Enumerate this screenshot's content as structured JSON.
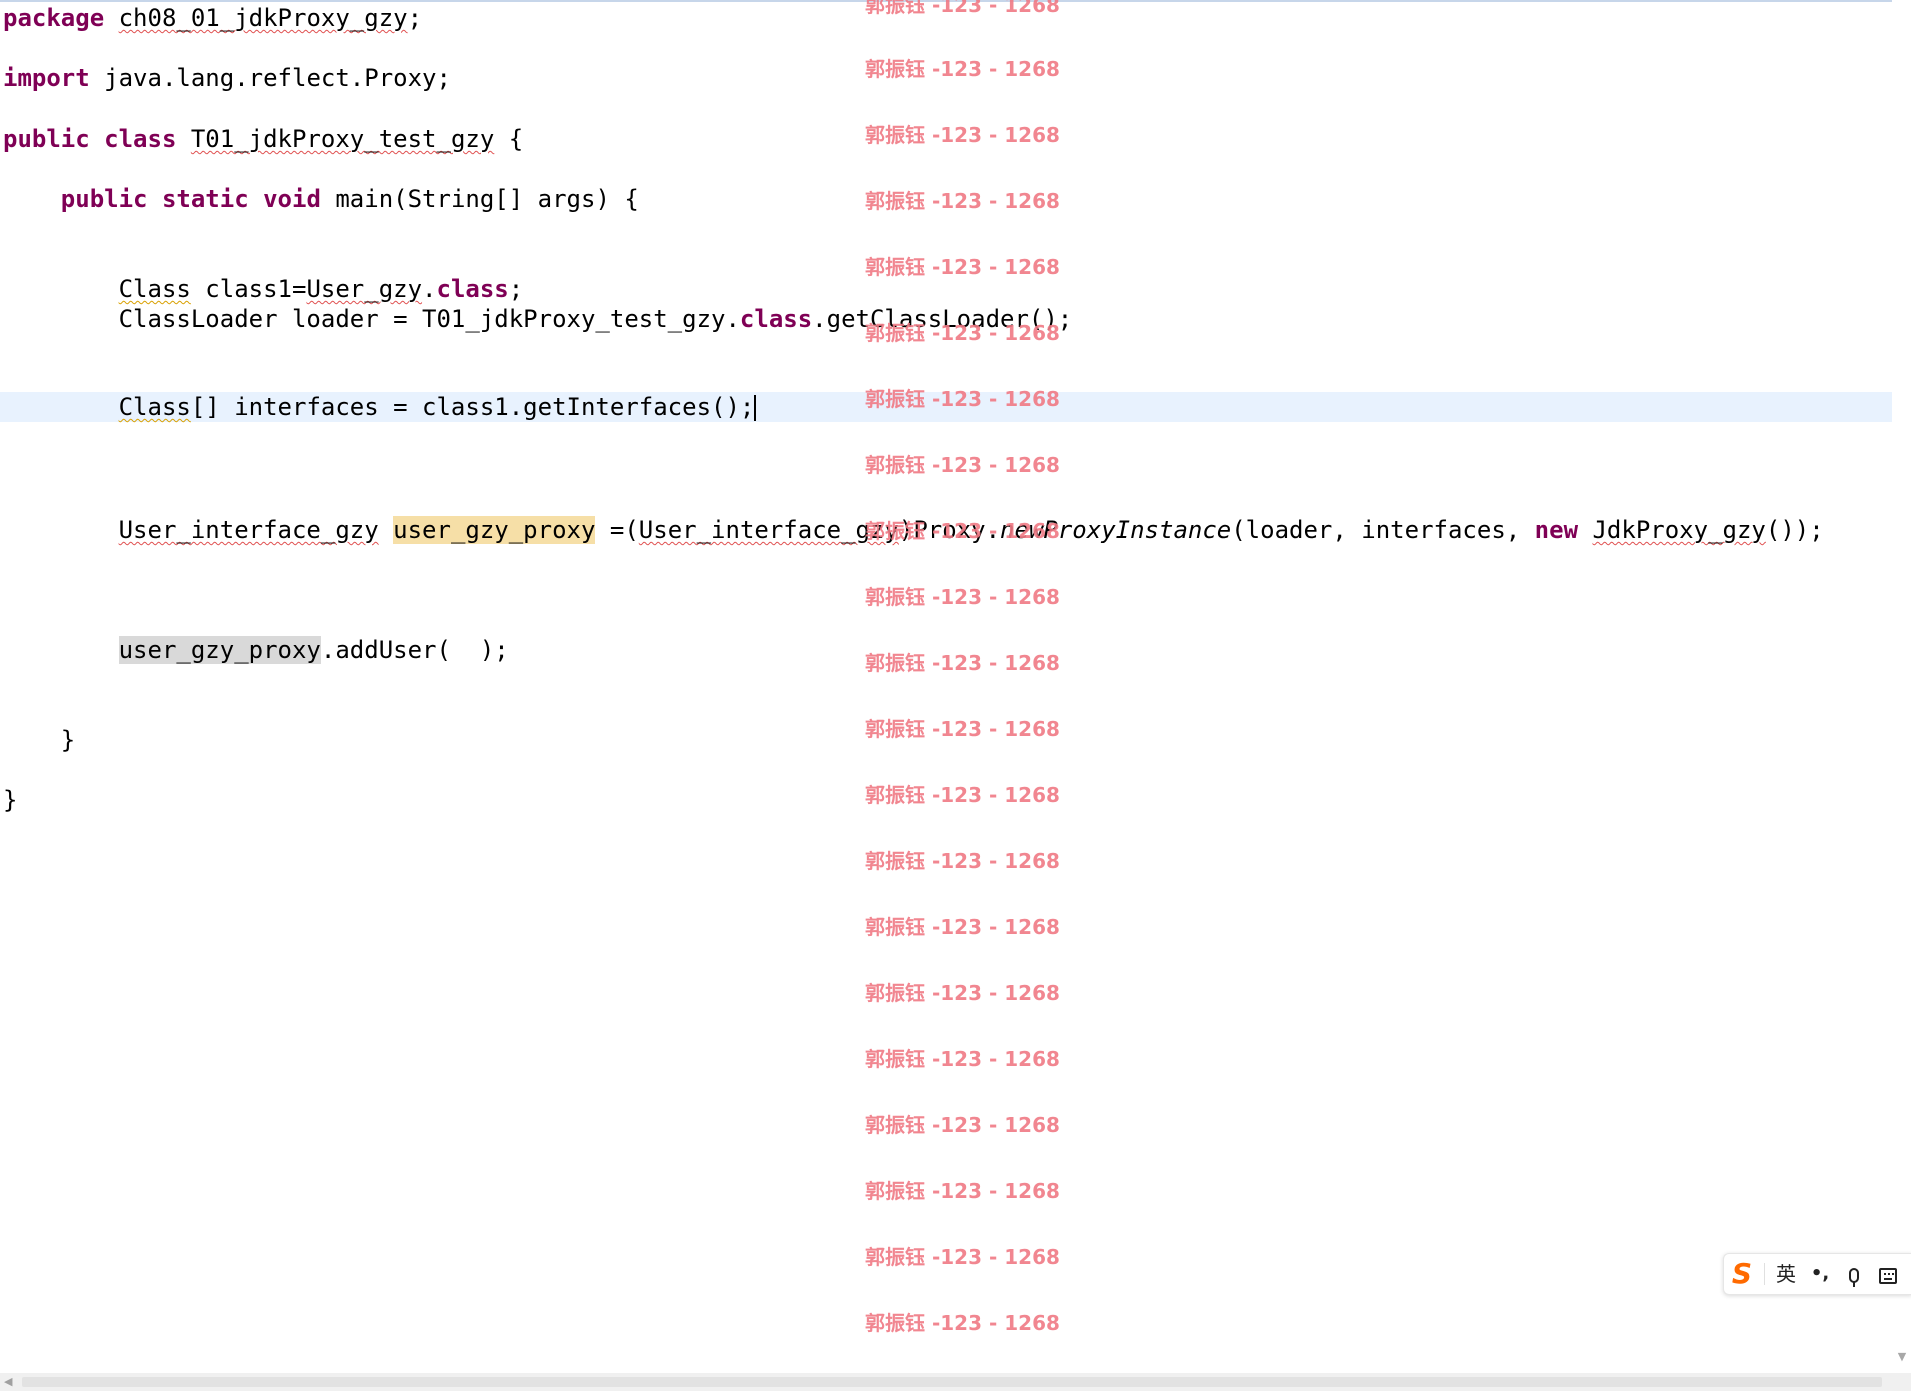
{
  "code": {
    "l1": {
      "kw": "package",
      "pkg": "ch08_01_jdkProxy_gzy",
      "semi": ";"
    },
    "l2": {
      "kw": "import",
      "rest": "java.lang.reflect.Proxy;"
    },
    "l3": {
      "kw1": "public",
      "kw2": "class",
      "name": "T01_jdkProxy_test_gzy",
      "brace": "{"
    },
    "l4": {
      "kw1": "public",
      "kw2": "static",
      "kw3": "void",
      "sig": "main(String[] args) {"
    },
    "l5": {
      "type": "Class",
      "mid": "class1=",
      "cls": "User_gzy",
      "dot": ".",
      "kw": "class",
      "semi": ";"
    },
    "l6": {
      "pre": "ClassLoader loader = T01_jdkProxy_test_gzy.",
      "kw": "class",
      "post": ".getClassLoader();"
    },
    "l7": {
      "type": "Class",
      "rest": "[] interfaces = class1.getInterfaces();"
    },
    "l8": {
      "type": "User_interface_gzy",
      "var": "user_gzy_proxy",
      "cast_open": "=(",
      "cast_type": "User_interface_gzy",
      "cast_close": ")",
      "proxy": "Proxy.",
      "method": "newProxyInstance",
      "args": "(loader, interfaces, ",
      "kw": "new",
      "ctor": "JdkProxy_gzy",
      "end": "());"
    },
    "l9": {
      "var": "user_gzy_proxy",
      "rest": ".addUser(  );"
    },
    "l10": {
      "brace": "}"
    },
    "l11": {
      "brace": "}"
    }
  },
  "watermark": {
    "text": "郭振钰 -123 - 1268"
  },
  "ime": {
    "logo": "S",
    "mode": "英",
    "punct": "•,",
    "icons": [
      "sogou-logo-icon",
      "mic-icon",
      "keyboard-icon"
    ]
  },
  "colors": {
    "keyword": "#7f0055",
    "current_line": "#e8f2fe",
    "occurrence_decl": "#f6dfa7",
    "occurrence_use": "#d9d9d9",
    "watermark": "#f07a85",
    "ime_logo": "#ff6a00"
  }
}
